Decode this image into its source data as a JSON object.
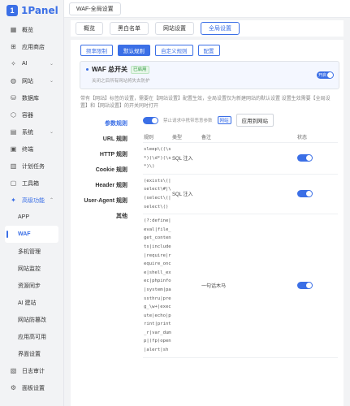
{
  "brand": {
    "name": "1Panel",
    "mark": "1"
  },
  "sidebar": {
    "items": [
      {
        "label": "概览",
        "icon": "dashboard-icon"
      },
      {
        "label": "应用商店",
        "icon": "app-store-icon"
      },
      {
        "label": "AI",
        "icon": "ai-icon",
        "chevron": "⌄"
      },
      {
        "label": "网站",
        "icon": "globe-icon",
        "chevron": "⌄"
      },
      {
        "label": "数据库",
        "icon": "database-icon"
      },
      {
        "label": "容器",
        "icon": "container-icon"
      },
      {
        "label": "系统",
        "icon": "system-icon",
        "chevron": "⌄"
      },
      {
        "label": "终端",
        "icon": "terminal-icon"
      },
      {
        "label": "计划任务",
        "icon": "calendar-icon"
      },
      {
        "label": "工具箱",
        "icon": "toolbox-icon"
      },
      {
        "label": "高级功能",
        "icon": "star-icon",
        "chevron": "⌃"
      }
    ],
    "sub_items": [
      "APP",
      "WAF",
      "多机管理",
      "网站监控",
      "资源同步",
      "AI 建站",
      "网站防篡改",
      "应用高可用",
      "界面设置"
    ],
    "bottom_items": [
      {
        "label": "日志审计",
        "icon": "log-icon"
      },
      {
        "label": "面板设置",
        "icon": "settings-icon"
      }
    ]
  },
  "topbar": {
    "breadcrumb": "WAF-全局设置"
  },
  "tabs": [
    "概览",
    "黑白名单",
    "网站设置",
    "全局设置"
  ],
  "subtabs": [
    "频率限制",
    "默认规则",
    "自定义规则",
    "配置"
  ],
  "waf": {
    "title": "WAF 总开关",
    "badge": "已启用",
    "desc": "关闭之后所有网站将失去防护",
    "switch_label": "开启"
  },
  "notice": "带有【网站】标签的设置，需要在【网站设置】配置生效，全局设置仅为新建网站的默认设置 设置生效需要【全局设置】和【网站设置】的开关同时打开",
  "rules_menu": [
    "参数规则",
    "URL 规则",
    "HTTP 规则",
    "Cookie 规则",
    "Header 规则",
    "User-Agent 规则",
    "其他"
  ],
  "rule_controls": {
    "desc": "禁止请求中携带恶意参数",
    "tag": "网站",
    "apply": "应用到网站"
  },
  "table": {
    "headers": [
      "规则",
      "类型",
      "备注",
      "状态"
    ],
    "rows": [
      {
        "rule": "sleep\\((\\s*)(\\d*)(\\s*)\\)",
        "type": "SQL 注入",
        "note": "",
        "enabled": true
      },
      {
        "rule": "(exists\\(|select\\#|\\(select\\(|select\\()",
        "type": "SQL 注入",
        "note": "",
        "enabled": true
      },
      {
        "rule": "(?:define|eval|file_get_contents|include|require|require_once|shell_exec|phpinfo|system|passthru|preg_\\w+|execute|echo|print|print_r|var_dump|(fp)open|alert|sh",
        "type": "",
        "note": "一句话木马",
        "enabled": true
      }
    ]
  },
  "colors": {
    "accent": "#3b6fe6",
    "success": "#2f9a3f"
  }
}
